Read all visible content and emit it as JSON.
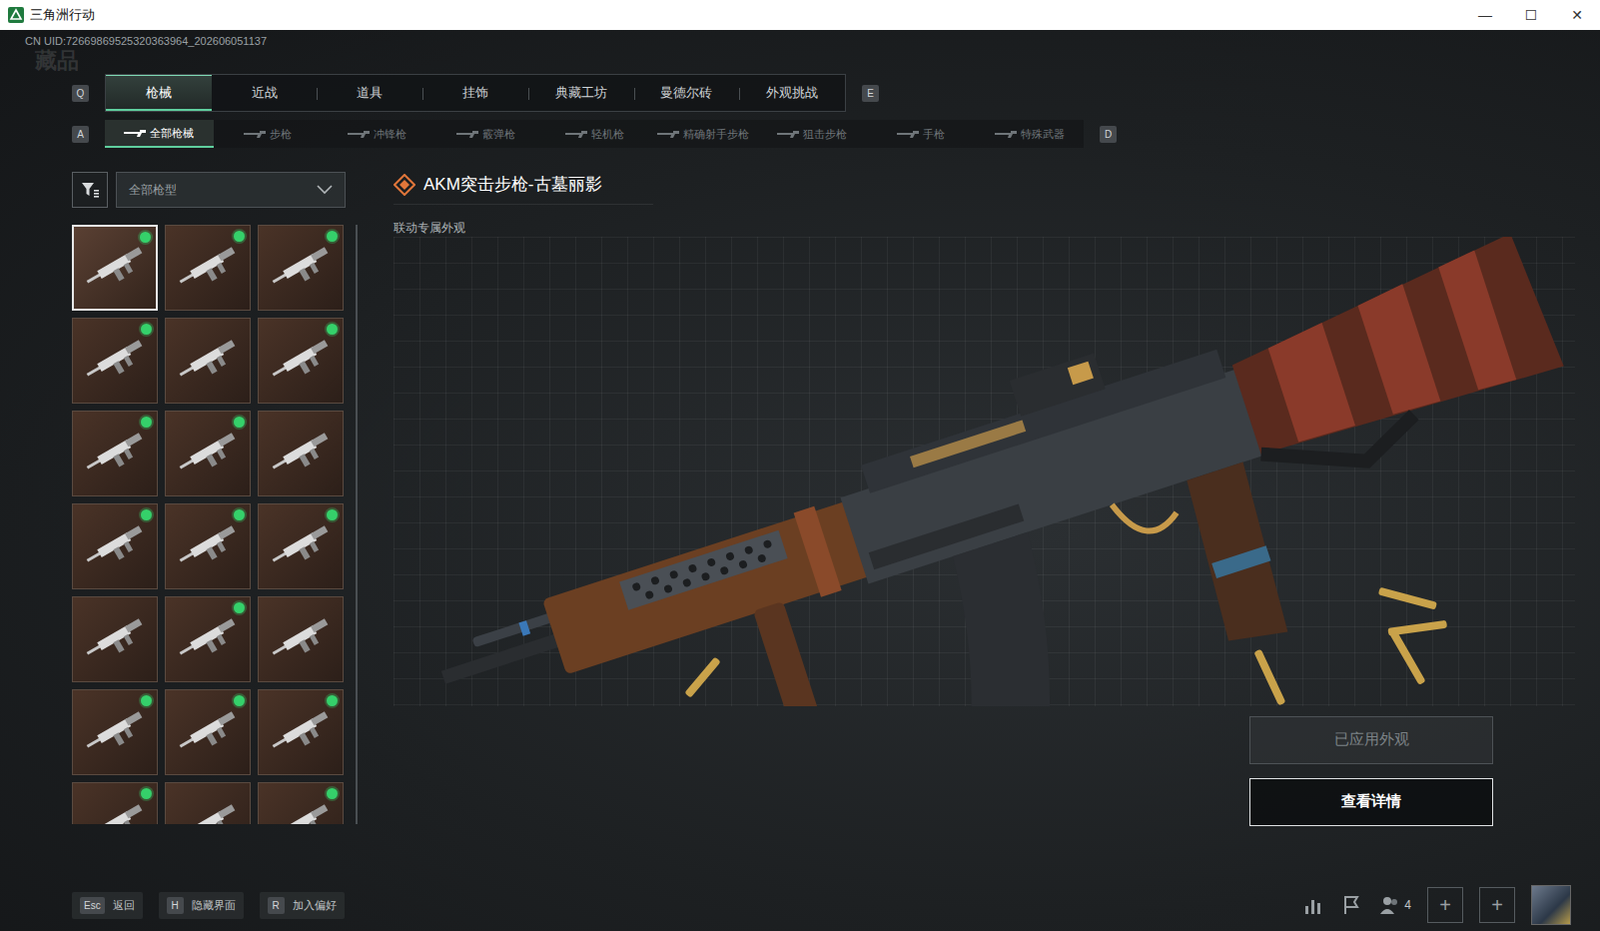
{
  "window": {
    "title": "三角洲行动",
    "controls": [
      "—",
      "☐",
      "✕"
    ]
  },
  "uid": "CN UID:72669869525320363964_202606051137",
  "watermark": "藏品",
  "tabs": {
    "prev_key": "Q",
    "next_key": "E",
    "items": [
      {
        "label": "枪械",
        "selected": true
      },
      {
        "label": "近战",
        "selected": false
      },
      {
        "label": "道具",
        "selected": false
      },
      {
        "label": "挂饰",
        "selected": false
      },
      {
        "label": "典藏工坊",
        "selected": false
      },
      {
        "label": "曼德尔砖",
        "selected": false
      },
      {
        "label": "外观挑战",
        "selected": false
      }
    ]
  },
  "subtabs": {
    "prev_key": "A",
    "next_key": "D",
    "items": [
      {
        "label": "全部枪械",
        "selected": true
      },
      {
        "label": "步枪",
        "selected": false
      },
      {
        "label": "冲锋枪",
        "selected": false
      },
      {
        "label": "霰弹枪",
        "selected": false
      },
      {
        "label": "轻机枪",
        "selected": false
      },
      {
        "label": "精确射手步枪",
        "selected": false
      },
      {
        "label": "狙击步枪",
        "selected": false
      },
      {
        "label": "手枪",
        "selected": false
      },
      {
        "label": "特殊武器",
        "selected": false
      }
    ]
  },
  "filter": {
    "value": "全部枪型"
  },
  "skins": [
    {
      "owned": true,
      "selected": true
    },
    {
      "owned": true,
      "selected": false
    },
    {
      "owned": true,
      "selected": false
    },
    {
      "owned": true,
      "selected": false
    },
    {
      "owned": false,
      "selected": false
    },
    {
      "owned": true,
      "selected": false
    },
    {
      "owned": true,
      "selected": false
    },
    {
      "owned": true,
      "selected": false
    },
    {
      "owned": false,
      "selected": false
    },
    {
      "owned": true,
      "selected": false
    },
    {
      "owned": true,
      "selected": false
    },
    {
      "owned": true,
      "selected": false
    },
    {
      "owned": false,
      "selected": false
    },
    {
      "owned": true,
      "selected": false
    },
    {
      "owned": false,
      "selected": false
    },
    {
      "owned": true,
      "selected": false
    },
    {
      "owned": true,
      "selected": false
    },
    {
      "owned": true,
      "selected": false
    },
    {
      "owned": true,
      "selected": false
    },
    {
      "owned": false,
      "selected": false
    },
    {
      "owned": true,
      "selected": false
    }
  ],
  "detail": {
    "title": "AKM突击步枪-古墓丽影",
    "subtitle": "联动专属外观"
  },
  "actions": [
    {
      "label": "已应用外观",
      "disabled": true
    },
    {
      "label": "查看详情",
      "disabled": false
    }
  ],
  "hints": [
    {
      "key": "Esc",
      "label": "返回"
    },
    {
      "key": "H",
      "label": "隐藏界面"
    },
    {
      "key": "R",
      "label": "加入偏好"
    }
  ],
  "squad": {
    "count": "4",
    "slots": [
      "+",
      "+"
    ]
  }
}
